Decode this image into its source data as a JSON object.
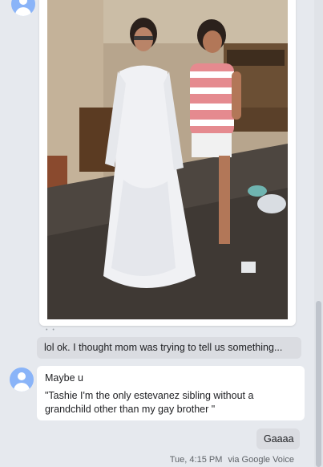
{
  "thread": {
    "messages": [
      {
        "id": "m1",
        "text": "lol ok. I thought mom was trying to tell us something..."
      },
      {
        "id": "m2",
        "text": "Maybe u"
      },
      {
        "id": "m3",
        "text": "\"Tashie I'm the only estevanez sibling without a grandchild other than my gay brother \""
      },
      {
        "id": "m4",
        "text": "Gaaaa"
      }
    ],
    "footer": {
      "time": "Tue, 4:15 PM",
      "source": "via Google Voice"
    }
  },
  "icons": {
    "avatar": "person-avatar-icon"
  },
  "colors": {
    "background": "#e6e9ee",
    "incoming_bubble": "#ffffff",
    "outgoing_bubble": "#dadce1",
    "avatar": "#8ab4f8"
  }
}
